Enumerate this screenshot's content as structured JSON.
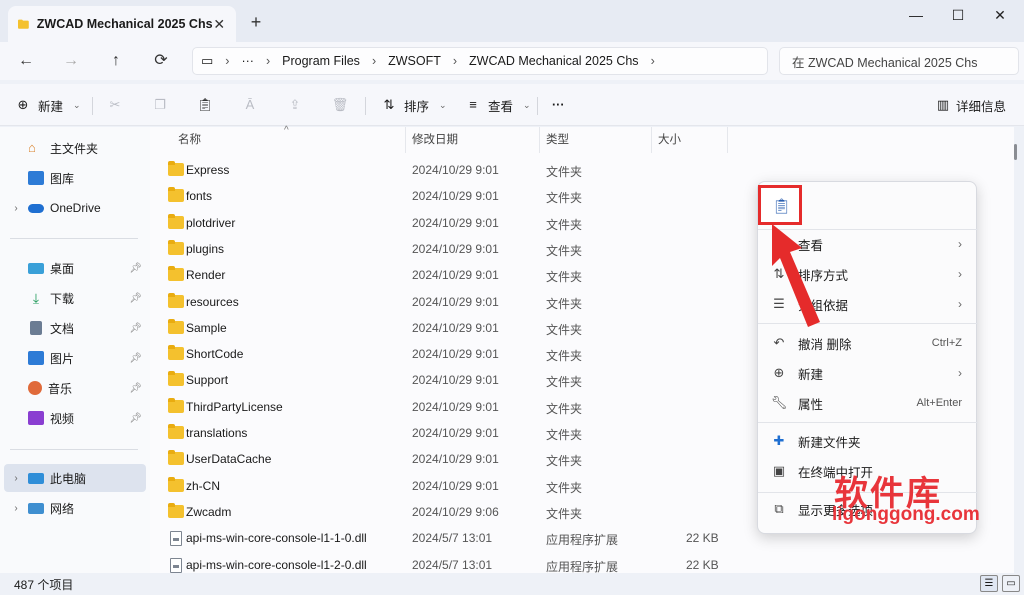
{
  "window": {
    "tab_title": "ZWCAD Mechanical 2025 Chs",
    "tab_close": "✕",
    "new_tab": "+",
    "minimize": "—",
    "maximize": "☐",
    "close": "✕"
  },
  "addressbar": {
    "path": [
      "Program Files",
      "ZWSOFT",
      "ZWCAD Mechanical 2025 Chs"
    ],
    "more": "···",
    "search_placeholder": "在 ZWCAD Mechanical 2025 Chs"
  },
  "commandbar": {
    "new_label": "新建",
    "sort_label": "排序",
    "view_label": "查看",
    "more": "···",
    "details_label": "详细信息"
  },
  "sidebar": {
    "items": [
      {
        "label": "主文件夹",
        "icon": "home-icon"
      },
      {
        "label": "图库",
        "icon": "gallery-icon"
      },
      {
        "label": "OneDrive",
        "icon": "cloud-icon"
      },
      {
        "label": "桌面",
        "icon": "desktop-icon"
      },
      {
        "label": "下载",
        "icon": "download-icon"
      },
      {
        "label": "文档",
        "icon": "document-icon"
      },
      {
        "label": "图片",
        "icon": "picture-icon"
      },
      {
        "label": "音乐",
        "icon": "music-icon"
      },
      {
        "label": "视频",
        "icon": "video-icon"
      },
      {
        "label": "此电脑",
        "icon": "computer-icon"
      },
      {
        "label": "网络",
        "icon": "network-icon"
      }
    ]
  },
  "filelist": {
    "columns": {
      "name": "名称",
      "date": "修改日期",
      "type": "类型",
      "size": "大小"
    },
    "rows": [
      {
        "name": "Express",
        "date": "2024/10/29 9:01",
        "type": "文件夹",
        "size": "",
        "kind": "folder"
      },
      {
        "name": "fonts",
        "date": "2024/10/29 9:01",
        "type": "文件夹",
        "size": "",
        "kind": "folder"
      },
      {
        "name": "plotdriver",
        "date": "2024/10/29 9:01",
        "type": "文件夹",
        "size": "",
        "kind": "folder"
      },
      {
        "name": "plugins",
        "date": "2024/10/29 9:01",
        "type": "文件夹",
        "size": "",
        "kind": "folder"
      },
      {
        "name": "Render",
        "date": "2024/10/29 9:01",
        "type": "文件夹",
        "size": "",
        "kind": "folder"
      },
      {
        "name": "resources",
        "date": "2024/10/29 9:01",
        "type": "文件夹",
        "size": "",
        "kind": "folder"
      },
      {
        "name": "Sample",
        "date": "2024/10/29 9:01",
        "type": "文件夹",
        "size": "",
        "kind": "folder"
      },
      {
        "name": "ShortCode",
        "date": "2024/10/29 9:01",
        "type": "文件夹",
        "size": "",
        "kind": "folder"
      },
      {
        "name": "Support",
        "date": "2024/10/29 9:01",
        "type": "文件夹",
        "size": "",
        "kind": "folder"
      },
      {
        "name": "ThirdPartyLicense",
        "date": "2024/10/29 9:01",
        "type": "文件夹",
        "size": "",
        "kind": "folder"
      },
      {
        "name": "translations",
        "date": "2024/10/29 9:01",
        "type": "文件夹",
        "size": "",
        "kind": "folder"
      },
      {
        "name": "UserDataCache",
        "date": "2024/10/29 9:01",
        "type": "文件夹",
        "size": "",
        "kind": "folder"
      },
      {
        "name": "zh-CN",
        "date": "2024/10/29 9:01",
        "type": "文件夹",
        "size": "",
        "kind": "folder"
      },
      {
        "name": "Zwcadm",
        "date": "2024/10/29 9:06",
        "type": "文件夹",
        "size": "",
        "kind": "folder"
      },
      {
        "name": "api-ms-win-core-console-l1-1-0.dll",
        "date": "2024/5/7 13:01",
        "type": "应用程序扩展",
        "size": "22 KB",
        "kind": "dll"
      },
      {
        "name": "api-ms-win-core-console-l1-2-0.dll",
        "date": "2024/5/7 13:01",
        "type": "应用程序扩展",
        "size": "22 KB",
        "kind": "dll"
      }
    ]
  },
  "statusbar": {
    "count": "487 个项目"
  },
  "contextmenu": {
    "items": [
      {
        "label": "查看",
        "icon": "grid-icon",
        "accel": "",
        "submenu": true
      },
      {
        "label": "排序方式",
        "icon": "sort-icon",
        "accel": "",
        "submenu": true
      },
      {
        "label": "分组依据",
        "icon": "group-icon",
        "accel": "",
        "submenu": true
      },
      {
        "label": "撤消 删除",
        "icon": "undo-icon",
        "accel": "Ctrl+Z",
        "submenu": false
      },
      {
        "label": "新建",
        "icon": "plus-circle-icon",
        "accel": "",
        "submenu": true
      },
      {
        "label": "属性",
        "icon": "wrench-icon",
        "accel": "Alt+Enter",
        "submenu": false
      },
      {
        "label": "新建文件夹",
        "icon": "new-folder-icon",
        "accel": "",
        "submenu": false
      },
      {
        "label": "在终端中打开",
        "icon": "terminal-icon",
        "accel": "",
        "submenu": false
      },
      {
        "label": "显示更多选项",
        "icon": "more-options-icon",
        "accel": "",
        "submenu": false
      }
    ]
  },
  "watermark": {
    "title": "软件库",
    "url": "ligonggong.com"
  },
  "colors": {
    "accent": "#e52b2b",
    "folder": "#f4c12e",
    "watermark": "#e8353b"
  }
}
